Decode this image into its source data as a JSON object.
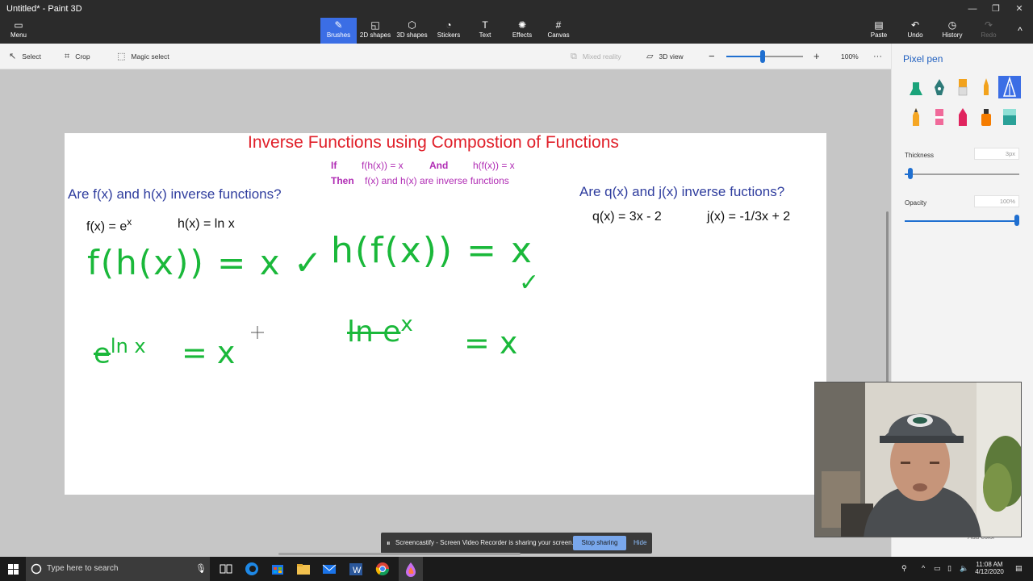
{
  "window": {
    "title": "Untitled* - Paint 3D",
    "controls": [
      "—",
      "❐",
      "✕"
    ]
  },
  "ribbon": {
    "menu": "Menu",
    "tabs": [
      {
        "label": "Brushes",
        "icon": "brush-icon",
        "glyph": "✎"
      },
      {
        "label": "2D shapes",
        "icon": "2d-shapes-icon",
        "glyph": "◱"
      },
      {
        "label": "3D shapes",
        "icon": "3d-shapes-icon",
        "glyph": "⬡"
      },
      {
        "label": "Stickers",
        "icon": "stickers-icon",
        "glyph": "◔"
      },
      {
        "label": "Text",
        "icon": "text-icon",
        "glyph": "T"
      },
      {
        "label": "Effects",
        "icon": "effects-icon",
        "glyph": "✺"
      },
      {
        "label": "Canvas",
        "icon": "canvas-icon",
        "glyph": "#"
      }
    ],
    "right": [
      {
        "label": "Paste",
        "icon": "paste-icon",
        "glyph": "📋"
      },
      {
        "label": "Undo",
        "icon": "undo-icon",
        "glyph": "↶"
      },
      {
        "label": "History",
        "icon": "history-icon",
        "glyph": "◷"
      },
      {
        "label": "Redo",
        "icon": "redo-icon",
        "glyph": "↷"
      }
    ],
    "collapse": "^"
  },
  "toolbar": {
    "select": "Select",
    "crop": "Crop",
    "magic_select": "Magic select",
    "mixed_reality": "Mixed reality",
    "view_3d": "3D view",
    "zoom_out": "−",
    "zoom_in": "+",
    "zoom_level": "100%",
    "more": "···",
    "zoom_percent": 47
  },
  "canvas": {
    "title": "Inverse Functions using Compostion of Functions",
    "rule": {
      "if": "If",
      "fhx": "f(h(x)) = x",
      "and": "And",
      "hfx": "h(f(x)) = x",
      "then": "Then",
      "then_text": "f(x) and h(x) are inverse functions"
    },
    "left_q": "Are f(x) and h(x) inverse functions?",
    "f_def_base": "f(x) = e",
    "f_def_exp": "x",
    "h_def": "h(x) = ln x",
    "right_q": "Are q(x) and j(x) inverse fuctions?",
    "q_def": "q(x) = 3x - 2",
    "j_def": "j(x) = -1/3x + 2",
    "hw1": "f(h(x)) = x ✓",
    "hw2": "h(f(x)) = x",
    "hw2_check": "✓",
    "hw3_base": "e",
    "hw3_exp": "ln x",
    "hw3_rhs": "= x",
    "hw4_base": "ln e",
    "hw4_exp": "x",
    "hw4_rhs": "= x",
    "colors": {
      "title": "#e0202a",
      "question": "#2f3d9e",
      "rule": "#b02cb4",
      "ink": "#1ab83a"
    }
  },
  "side_panel": {
    "title": "Pixel pen",
    "thickness_label": "Thickness",
    "thickness_value": "3px",
    "thickness_fraction": 0.03,
    "opacity_label": "Opacity",
    "opacity_value": "100%",
    "opacity_fraction": 1.0,
    "add_color": "Add color",
    "brushes": [
      {
        "name": "marker-icon",
        "color": "#1aa37a"
      },
      {
        "name": "calligraphy-pen-icon",
        "color": "#2d7a78"
      },
      {
        "name": "oil-brush-icon",
        "color": "#f2a21c"
      },
      {
        "name": "watercolor-icon",
        "color": "#f2a21c"
      },
      {
        "name": "pixel-pen-icon",
        "color": "#ffffff"
      },
      {
        "name": "pencil-icon",
        "color": "#f5a623"
      },
      {
        "name": "eraser-icon",
        "color": "#f06a9a"
      },
      {
        "name": "crayon-icon",
        "color": "#e0245e"
      },
      {
        "name": "spray-can-icon",
        "color": "#f57c00"
      },
      {
        "name": "fill-icon",
        "color": "#2aa198"
      }
    ]
  },
  "notification": {
    "text": "Screencastify - Screen Video Recorder is sharing your screen.",
    "stop": "Stop sharing",
    "hide": "Hide"
  },
  "taskbar": {
    "search_placeholder": "Type here to search",
    "time": "11:08 AM",
    "date": "4/12/2020"
  }
}
